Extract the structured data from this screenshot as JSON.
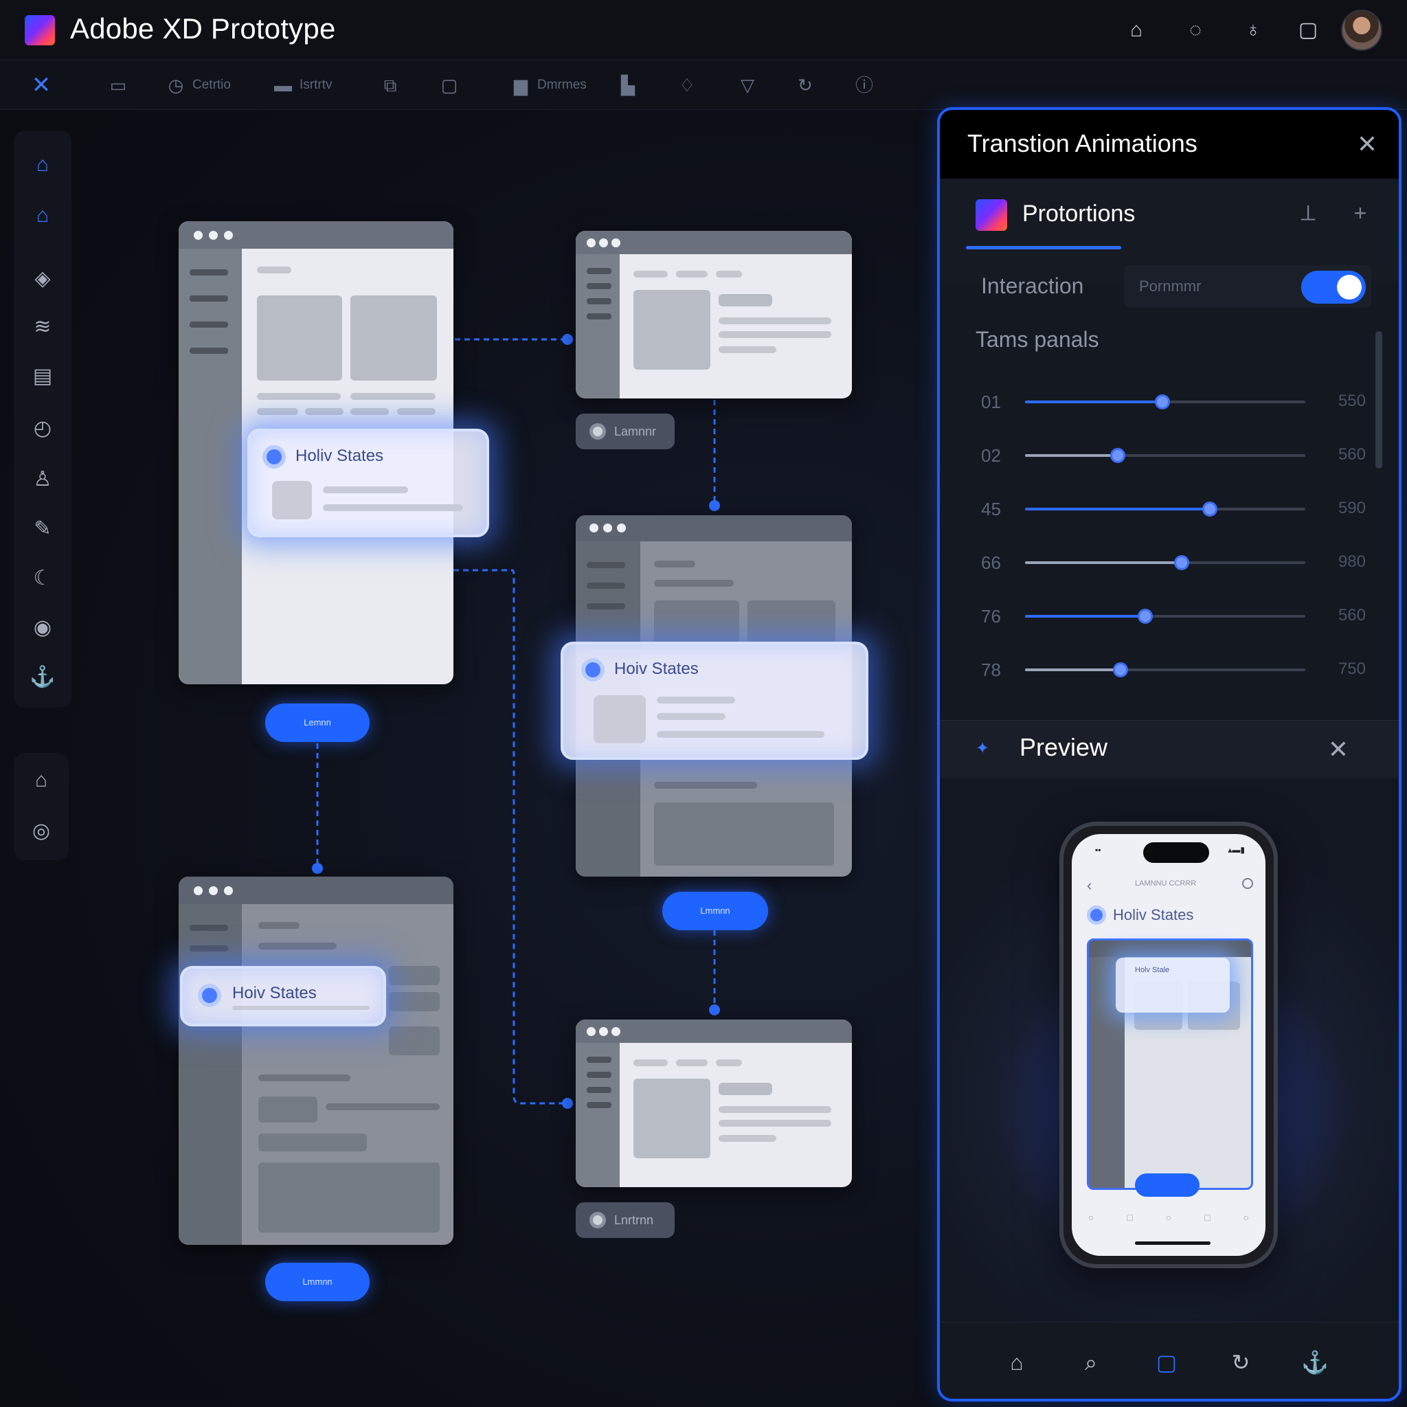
{
  "app": {
    "title": "Adobe XD Prototype"
  },
  "titlebar_icons": [
    "home-icon",
    "chat-icon",
    "bell-icon",
    "settings-icon"
  ],
  "toolbar": {
    "items": [
      {
        "icon": "close-icon",
        "label": ""
      },
      {
        "icon": "layers-icon",
        "label": ""
      },
      {
        "icon": "clock-icon",
        "label": "Cetrtio"
      },
      {
        "icon": "screen-icon",
        "label": "Isrtrtv"
      },
      {
        "icon": "copy-icon",
        "label": ""
      },
      {
        "icon": "square-icon",
        "label": ""
      },
      {
        "icon": "folder-icon",
        "label": "Dmrmes"
      },
      {
        "icon": "chart-icon",
        "label": ""
      },
      {
        "icon": "bell-icon",
        "label": ""
      },
      {
        "icon": "shield-icon",
        "label": ""
      },
      {
        "icon": "refresh-icon",
        "label": ""
      },
      {
        "icon": "info-icon",
        "label": ""
      }
    ]
  },
  "canvas": {
    "states": [
      {
        "label": "Holiv States"
      },
      {
        "label": "Hoiv States"
      },
      {
        "label": "Hoiv States"
      }
    ],
    "tags": [
      "Lamnnr",
      "Lnrtrnn"
    ],
    "pills": [
      "Lemnn",
      "Lmmnn",
      "Lmmnn"
    ]
  },
  "panel": {
    "title": "Transtion Animations",
    "section": {
      "title": "Protortions"
    },
    "interaction": {
      "label": "Interaction",
      "field_placeholder": "Pornmmr",
      "toggle_on": true
    },
    "group_label": "Tams panals",
    "sliders": [
      {
        "num": "01",
        "value": 0.49,
        "max": "550"
      },
      {
        "num": "02",
        "value": 0.33,
        "max": "560"
      },
      {
        "num": "45",
        "value": 0.66,
        "max": "590"
      },
      {
        "num": "66",
        "value": 0.56,
        "max": "980"
      },
      {
        "num": "76",
        "value": 0.43,
        "max": "560"
      },
      {
        "num": "78",
        "value": 0.34,
        "max": "750"
      }
    ],
    "preview": {
      "title": "Preview",
      "phone": {
        "header": "LAMNNU CCRRR",
        "state_label": "Holiv States",
        "card_label": "Holv Stale"
      }
    },
    "tabs": [
      "home-icon",
      "search-icon",
      "square-icon",
      "refresh-icon",
      "anchor-icon"
    ],
    "active_tab": 2
  },
  "colors": {
    "accent": "#1f64ff",
    "panel_border": "#1f5dff",
    "bg": "#0b0d13"
  }
}
